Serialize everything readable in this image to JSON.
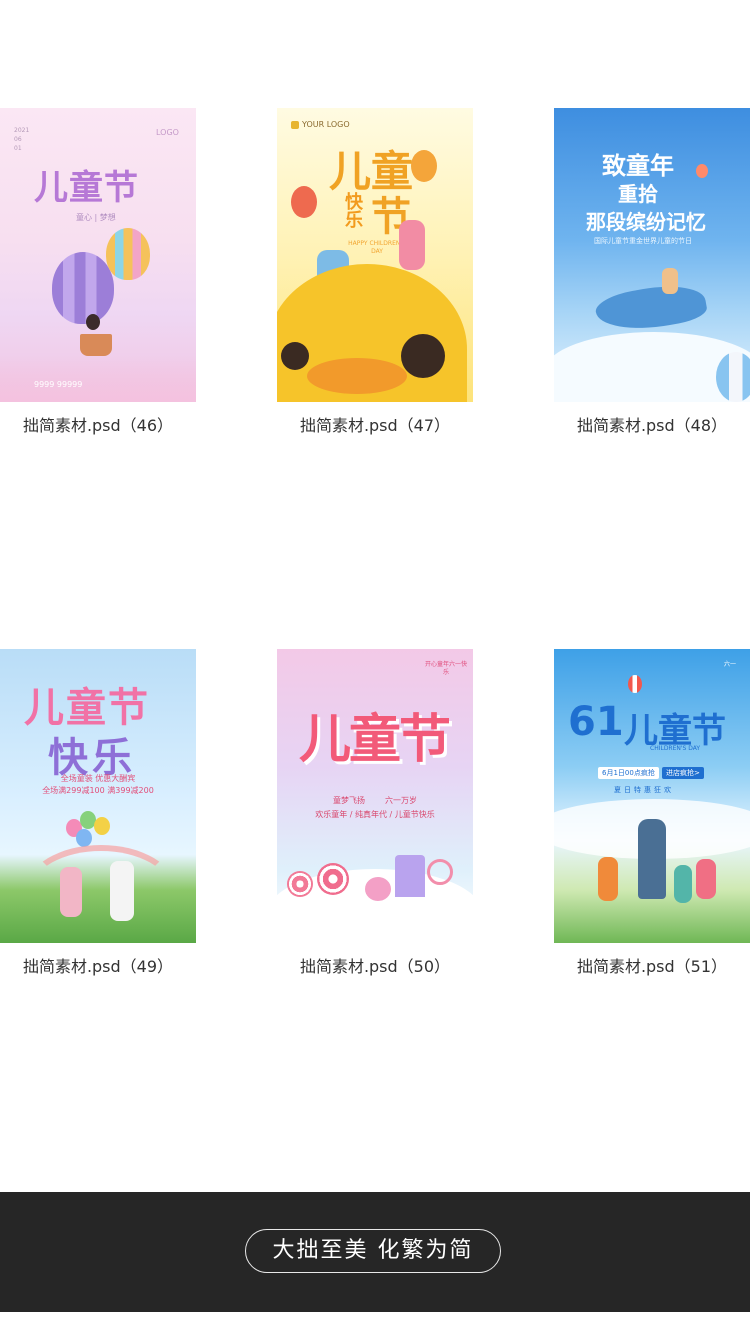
{
  "gallery": {
    "items": [
      {
        "caption": "拙简素材.psd（46）",
        "title": "儿童节",
        "sub": "童心 | 梦想",
        "logo": "LOGO",
        "date": [
          "2021",
          "06",
          "01"
        ],
        "footer_text": "9999 99999"
      },
      {
        "caption": "拙简素材.psd（47）",
        "logo": "YOUR LOGO",
        "title_a": "儿童",
        "title_b": "节",
        "title_c": "快乐",
        "en": "HAPPY CHILDREN'S DAY"
      },
      {
        "caption": "拙简素材.psd（48）",
        "line1": "致童年",
        "line2": "重拾",
        "line3": "那段缤纷记忆",
        "sub": "国际儿童节重金世界儿童的节日"
      },
      {
        "caption": "拙简素材.psd（49）",
        "title_a": "儿童节",
        "title_b": "快乐",
        "promo1": "全场童装 优惠大酬宾",
        "promo2": "全场满299减100 满399减200"
      },
      {
        "caption": "拙简素材.psd（50）",
        "top_note": "开心童年六一快乐",
        "title": "儿童节",
        "tags": [
          "童梦飞扬",
          "六一万岁"
        ],
        "line": "欢乐童年 / 纯真年代 / 儿童节快乐"
      },
      {
        "caption": "拙简素材.psd（51）",
        "badge": "六一",
        "title_num": "61",
        "title": "儿童节",
        "en": "CHILDREN'S DAY",
        "date_tag": "6月1日00点疯抢",
        "cta": "进店疯抢>",
        "features": [
          "夏",
          "日",
          "特",
          "惠",
          "狂",
          "欢"
        ]
      }
    ]
  },
  "footer": {
    "slogan": "大拙至美 化繁为简"
  },
  "colors": {
    "footer_bg": "#262626",
    "caption_text": "#333333"
  }
}
